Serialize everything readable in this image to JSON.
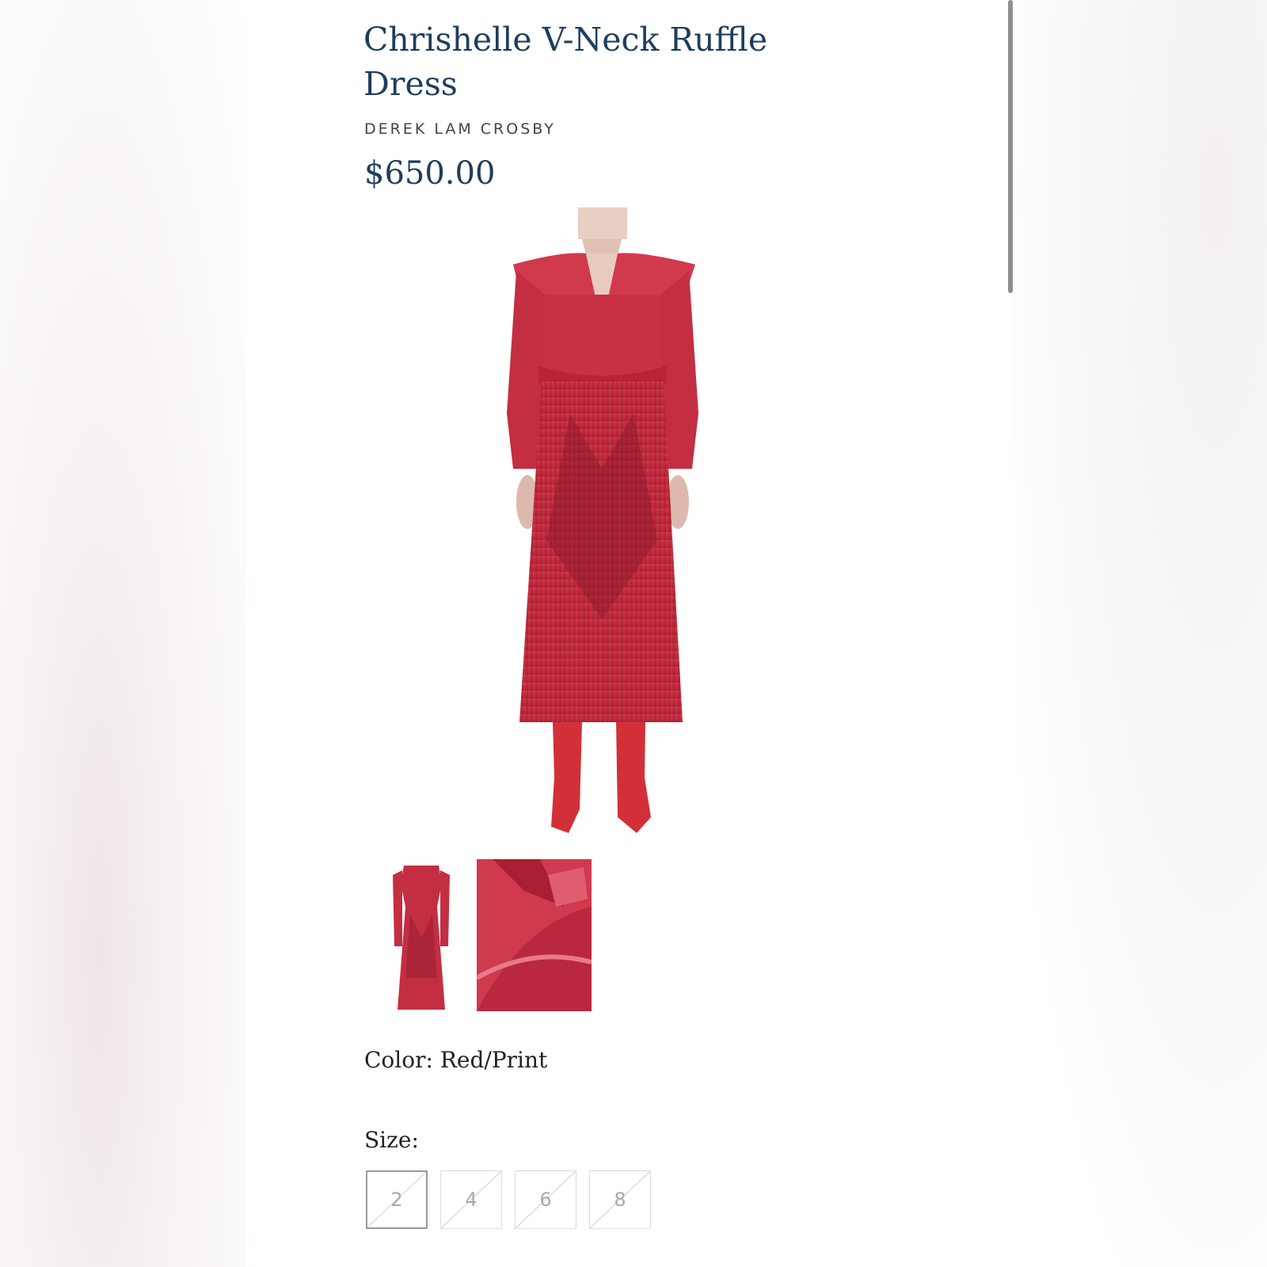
{
  "product": {
    "title": "Chrishelle V-Neck Ruffle Dress",
    "brand": "DEREK LAM CROSBY",
    "price": "$650.00",
    "color_label": "Color: Red/Print",
    "size_label": "Size:",
    "sizes": [
      "2",
      "4",
      "6",
      "8"
    ],
    "selected_size": "2",
    "sizes_unavailable": true
  },
  "colors": {
    "title": "#1e3d5c",
    "dress": "#c8283a",
    "boots": "#d23038"
  }
}
